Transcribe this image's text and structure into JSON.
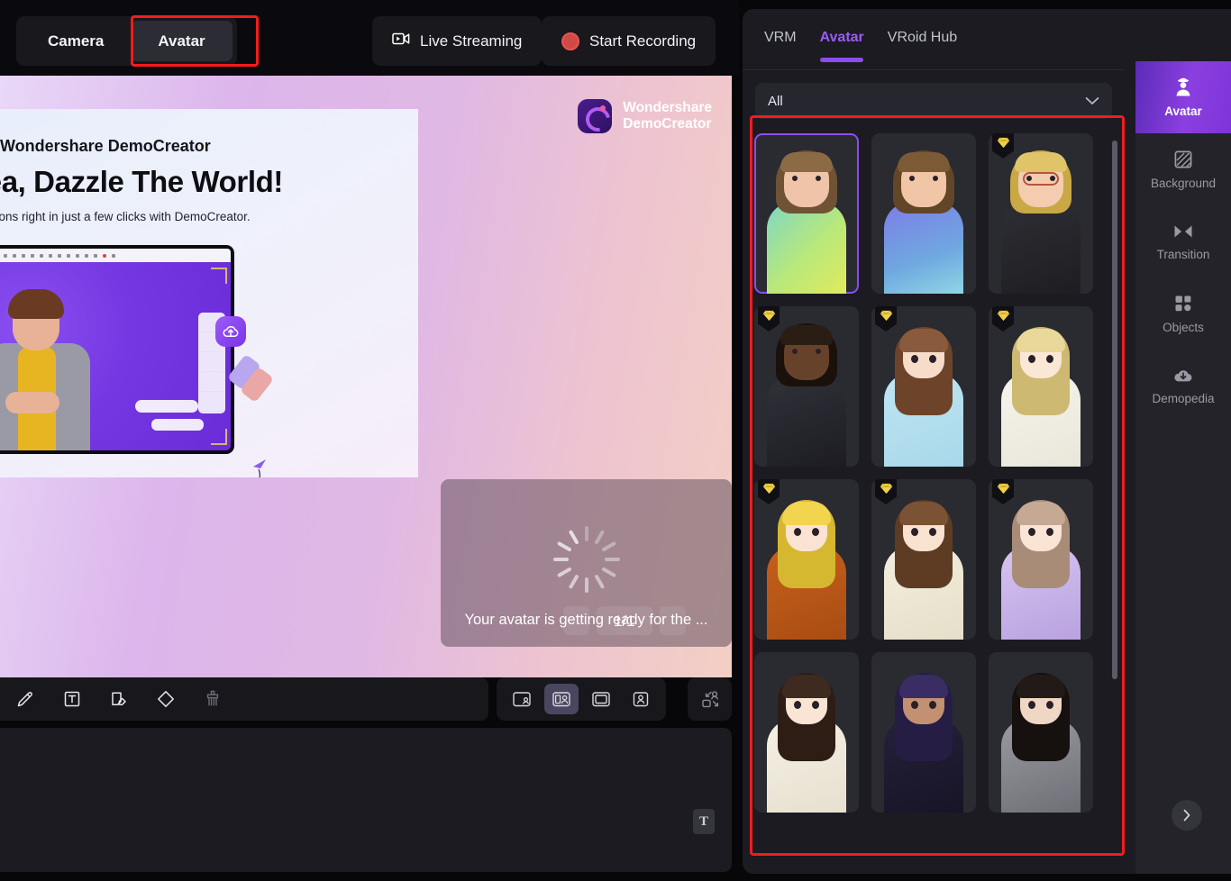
{
  "header": {
    "mode_tabs": [
      {
        "label": "Camera",
        "active": false
      },
      {
        "label": "Avatar",
        "active": true
      }
    ],
    "live_streaming_label": "Live Streaming",
    "start_recording_label": "Start Recording"
  },
  "stage": {
    "slide": {
      "brand": "Wondershare DemoCreator",
      "headline": "r Idea, Dazzle The World!",
      "subtext": "o presentations right in just a few clicks with DemoCreator."
    },
    "watermark": {
      "line1": "Wondershare",
      "line2": "DemoCreator"
    },
    "loading": {
      "message": "Your avatar is getting ready for the ...",
      "count": "1/1"
    }
  },
  "toolbar": {
    "tools": [
      {
        "name": "pen-icon",
        "label": "Pen",
        "dim": false
      },
      {
        "name": "text-icon",
        "label": "Text",
        "dim": false
      },
      {
        "name": "note-icon",
        "label": "Note",
        "dim": false
      },
      {
        "name": "shape-icon",
        "label": "Shape",
        "dim": false
      },
      {
        "name": "eraser-brush-icon",
        "label": "Clear",
        "dim": true
      }
    ],
    "layout_modes": [
      {
        "name": "layout-pip-corner-icon",
        "label": "Picture in Picture",
        "active": false
      },
      {
        "name": "layout-split-icon",
        "label": "Split View",
        "active": true
      },
      {
        "name": "layout-screen-only-icon",
        "label": "Screen Only",
        "active": false
      },
      {
        "name": "layout-avatar-only-icon",
        "label": "Avatar Only",
        "active": false
      }
    ],
    "swap_label": "Swap Layout",
    "text_button_label": "T"
  },
  "right_panel": {
    "tabs": [
      {
        "label": "VRM",
        "active": false
      },
      {
        "label": "Avatar",
        "active": true
      },
      {
        "label": "VRoid Hub",
        "active": false
      }
    ],
    "filter": {
      "value": "All",
      "placeholder": "All"
    },
    "avatars": [
      {
        "id": 1,
        "name": "Casual Woman Green Shirt",
        "premium": false,
        "selected": true,
        "hair": "#8c6a45",
        "hair2": "#6f5334",
        "skin": "#f0c4a8",
        "top": "linear-gradient(135deg,#7fd7c4 0%,#b9e87a 55%,#e2ea5c 100%)",
        "bg": "#2a2a31",
        "style": "3d",
        "glasses": false
      },
      {
        "id": 2,
        "name": "Casual Man Blue Shirt",
        "premium": false,
        "selected": false,
        "hair": "#7d5a36",
        "hair2": "#634528",
        "skin": "#f1c6a6",
        "top": "linear-gradient(160deg,#7d7ce8 0%,#6fa8e0 60%,#8fd6e4 100%)",
        "bg": "#2a2a31",
        "style": "3d",
        "glasses": false
      },
      {
        "id": 3,
        "name": "Business Woman Glasses",
        "premium": true,
        "selected": false,
        "hair": "#e0c46a",
        "hair2": "#c9a845",
        "skin": "#f4cdb0",
        "top": "linear-gradient(160deg,#2e2e34,#1d1d22)",
        "bg": "#2a2a31",
        "style": "3d",
        "glasses": true
      },
      {
        "id": 4,
        "name": "Business Man Suit",
        "premium": true,
        "selected": false,
        "hair": "#2a1d14",
        "hair2": "#1a110b",
        "skin": "#67422b",
        "top": "linear-gradient(160deg,#31313a,#1c1c22)",
        "bg": "#2a2a31",
        "style": "3d",
        "glasses": false
      },
      {
        "id": 5,
        "name": "Anime Girl Long Brown Hair",
        "premium": true,
        "selected": false,
        "hair": "#8a5a3c",
        "hair2": "#6d4429",
        "skin": "#f7ddc9",
        "top": "linear-gradient(160deg,#bfe5f2,#a8d8ea)",
        "bg": "#2a2a31",
        "style": "anime",
        "glasses": false
      },
      {
        "id": 6,
        "name": "Anime Boy White Shirt Tie",
        "premium": true,
        "selected": false,
        "hair": "#e8d89a",
        "hair2": "#cdb972",
        "skin": "#fbe7d6",
        "top": "linear-gradient(160deg,#f6f4ec,#e9e6da)",
        "bg": "#2a2a31",
        "style": "anime",
        "glasses": false
      },
      {
        "id": 7,
        "name": "Anime Boy Orange Varsity Jacket",
        "premium": true,
        "selected": false,
        "hair": "#f2d44e",
        "hair2": "#d6b830",
        "skin": "#fae3d2",
        "top": "linear-gradient(160deg,#c6601c,#a94d13)",
        "bg": "#2a2a31",
        "style": "anime",
        "glasses": false
      },
      {
        "id": 8,
        "name": "Anime Girl Cream Cardigan",
        "premium": true,
        "selected": false,
        "hair": "#7b5234",
        "hair2": "#5e3c24",
        "skin": "#fae2d0",
        "top": "linear-gradient(160deg,#f3eedd,#e6dfc9)",
        "bg": "#2a2a31",
        "style": "anime",
        "glasses": false
      },
      {
        "id": 9,
        "name": "Anime Elf Girl Purple Dress",
        "premium": true,
        "selected": false,
        "hair": "#c6a994",
        "hair2": "#a98c77",
        "skin": "#fae4d5",
        "top": "linear-gradient(160deg,#d6c4ef,#b9a2e0)",
        "bg": "#2a2a31",
        "style": "anime",
        "glasses": false
      },
      {
        "id": 10,
        "name": "Anime Girl Bob Cut White Cardigan",
        "premium": false,
        "selected": false,
        "hair": "#3f2a20",
        "hair2": "#2d1d15",
        "skin": "#fae5d4",
        "top": "linear-gradient(160deg,#f5f0e4,#e7e0d0)",
        "bg": "#2a2a31",
        "style": "anime",
        "glasses": false
      },
      {
        "id": 11,
        "name": "Anime Cat Girl Purple Hair",
        "premium": false,
        "selected": false,
        "hair": "#3a2d63",
        "hair2": "#261d45",
        "skin": "#c49072",
        "top": "linear-gradient(160deg,#24213a,#171427)",
        "bg": "#2a2a31",
        "style": "anime",
        "glasses": false
      },
      {
        "id": 12,
        "name": "Anime Boy Grey Hoodie",
        "premium": false,
        "selected": false,
        "hair": "#211a17",
        "hair2": "#16100e",
        "skin": "#f0d6c4",
        "top": "linear-gradient(160deg,#9a9aa0,#6e6e76)",
        "bg": "#2a2a31",
        "style": "anime",
        "glasses": false
      }
    ],
    "rail": [
      {
        "label": "Avatar",
        "icon": "avatar-person-icon",
        "active": true
      },
      {
        "label": "Background",
        "icon": "background-pattern-icon",
        "active": false
      },
      {
        "label": "Transition",
        "icon": "transition-arrows-icon",
        "active": false
      },
      {
        "label": "Objects",
        "icon": "objects-grid-icon",
        "active": false
      },
      {
        "label": "Demopedia",
        "icon": "cloud-download-icon",
        "active": false
      }
    ],
    "next_label": "Next"
  },
  "colors": {
    "accent_purple": "#8b4df0",
    "highlight_red": "#f51b1b",
    "record_red": "#cf4a45",
    "panel_bg": "#1b1b21",
    "gem_gold": "#f2d14a"
  }
}
